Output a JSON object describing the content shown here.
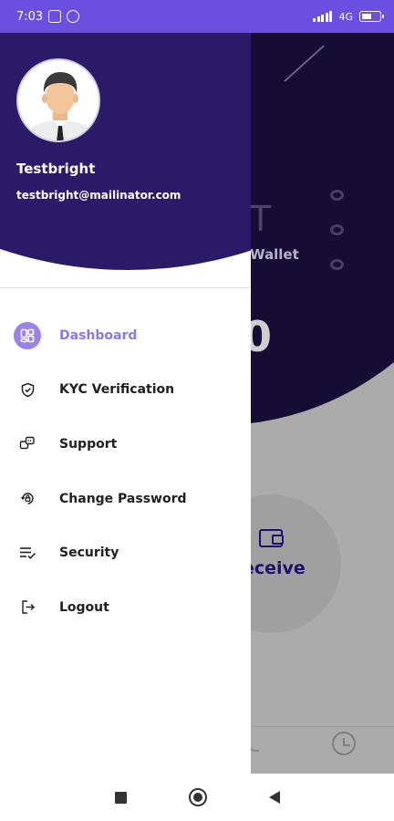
{
  "status_bar": {
    "time": "7:03",
    "network": "4G"
  },
  "background_app": {
    "partial_title": "T",
    "wallet_label": "Wallet",
    "partial_balance": "0",
    "receive_label": "eceive"
  },
  "drawer": {
    "user_name": "Testbright",
    "user_email": "testbright@mailinator.com",
    "menu_items": [
      {
        "label": "Dashboard",
        "icon": "dashboard-icon",
        "active": true
      },
      {
        "label": "KYC Verification",
        "icon": "shield-check-icon",
        "active": false
      },
      {
        "label": "Support",
        "icon": "support-chat-icon",
        "active": false
      },
      {
        "label": "Change Password",
        "icon": "password-icon",
        "active": false
      },
      {
        "label": "Security",
        "icon": "security-list-icon",
        "active": false
      },
      {
        "label": "Logout",
        "icon": "logout-icon",
        "active": false
      }
    ]
  },
  "colors": {
    "status_bar": "#6a4fe0",
    "drawer_header": "#2b1a68",
    "active_accent": "#8f76e6"
  }
}
